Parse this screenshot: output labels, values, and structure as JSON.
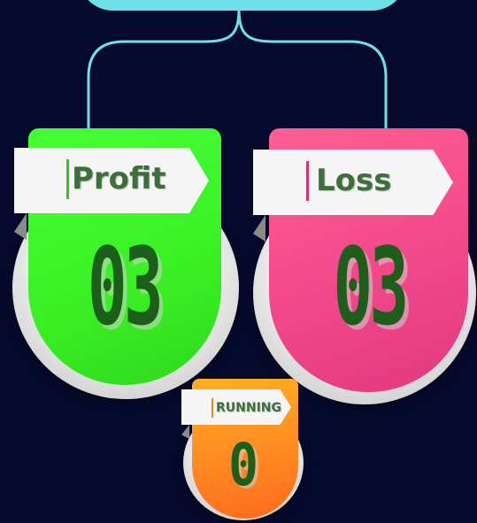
{
  "cards": {
    "profit": {
      "label": "Profit",
      "value": "03",
      "color": "#3dff2b",
      "accent": "#36c12a"
    },
    "loss": {
      "label": "Loss",
      "value": "03",
      "color": "#f04a88",
      "accent": "#d2306e"
    },
    "running": {
      "label": "RUNNING",
      "value": "0",
      "color": "#ff8a22",
      "accent": "#e88a18"
    }
  },
  "colors": {
    "background": "#050a2c",
    "connector": "#6ee0ea",
    "number": "#1d5e1a"
  }
}
